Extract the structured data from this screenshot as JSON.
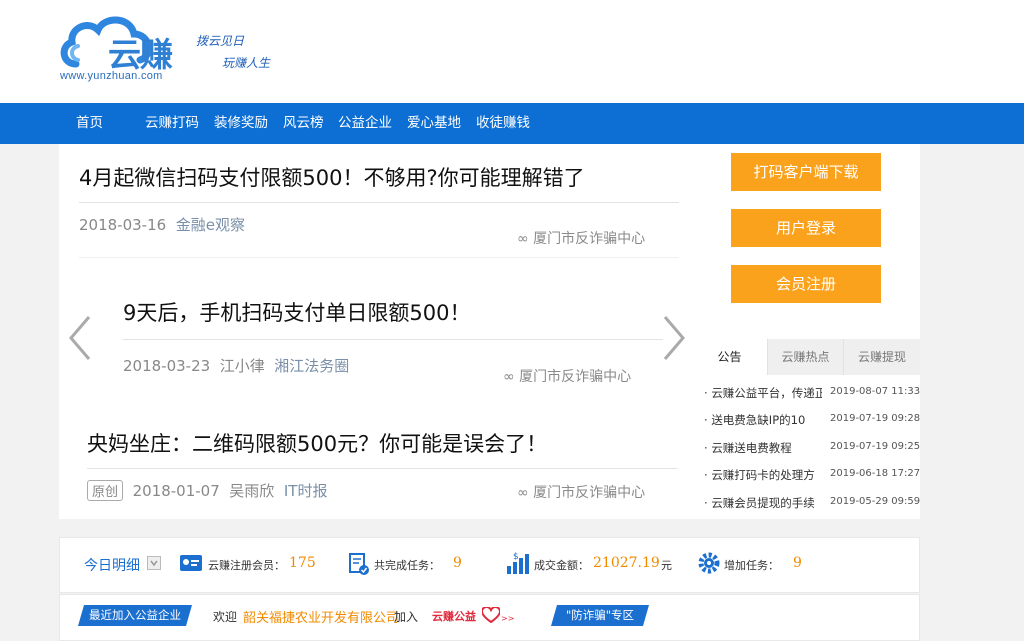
{
  "header": {
    "logo_text": "云赚",
    "logo_url": "www.yunzhuan.com",
    "slogan1": "拨云见日",
    "slogan2": "玩赚人生"
  },
  "nav": {
    "items": [
      "首页",
      "云赚打码",
      "装修奖励",
      "风云榜",
      "公益企业",
      "爱心基地",
      "收徒赚钱"
    ]
  },
  "banner": {
    "articles": [
      {
        "title": "4月起微信扫码支付限额500！不够用?你可能理解错了",
        "date": "2018-03-16",
        "source": "金融e观察",
        "watermark": "厦门市反诈骗中心"
      },
      {
        "title": "9天后，手机扫码支付单日限额500！",
        "date": "2018-03-23",
        "author": "江小律",
        "source": "湘江法务圈",
        "watermark": "厦门市反诈骗中心"
      },
      {
        "title": "央妈坐庄：二维码限额500元？你可能是误会了！",
        "badge": "原创",
        "date": "2018-01-07",
        "author": "吴雨欣",
        "source": "IT时报",
        "watermark": "厦门市反诈骗中心"
      }
    ]
  },
  "right": {
    "buttons": [
      "打码客户端下载",
      "用户登录",
      "会员注册"
    ],
    "tabs": [
      "公告",
      "云赚热点",
      "云赚提现"
    ],
    "notices": [
      {
        "title": "云赚公益平台，传递正",
        "date": "2019-08-07 11:33"
      },
      {
        "title": "送电费急缺IP的10",
        "date": "2019-07-19 09:28"
      },
      {
        "title": "云赚送电费教程",
        "date": "2019-07-19 09:25"
      },
      {
        "title": "云赚打码卡的处理方",
        "date": "2019-06-18 17:27"
      },
      {
        "title": "云赚会员提现的手续",
        "date": "2019-05-29 09:59"
      }
    ]
  },
  "stats": {
    "today_label": "今日明细",
    "registered_label": "云赚注册会员：",
    "registered_value": "175",
    "tasks_done_label": "共完成任务：",
    "tasks_done_value": "9",
    "amount_label": "成交金额：",
    "amount_value": "21027.19",
    "amount_unit": "元",
    "added_tasks_label": "增加任务：",
    "added_tasks_value": "9"
  },
  "bottom": {
    "ribbon_left": "最近加入公益企业",
    "welcome": "欢迎",
    "company": "韶关福捷农业开发有限公司",
    "join": "加入",
    "charity_logo": "云赚公益",
    "charity_arrows": ">>",
    "ribbon_right": "\"防诈骗\"专区"
  },
  "colors": {
    "nav_bg": "#0d6fd4",
    "button_orange": "#fba21d",
    "stat_value": "#f08a00",
    "logo_blue": "#2f7fd3"
  }
}
